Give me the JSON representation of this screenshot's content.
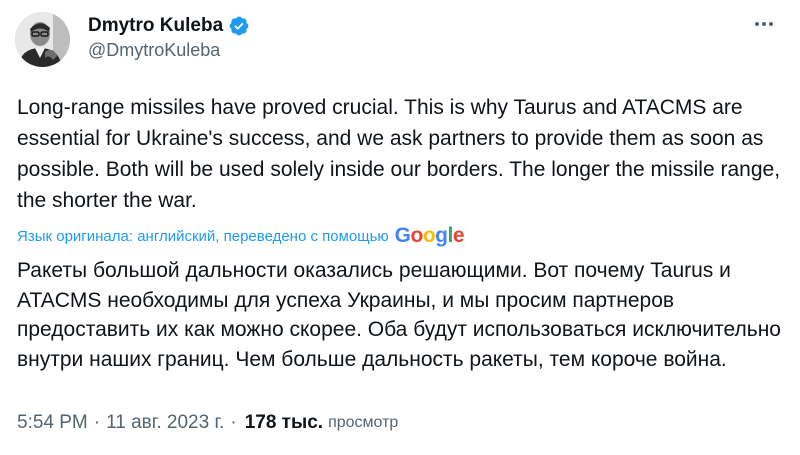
{
  "author": {
    "display_name": "Dmytro Kuleba",
    "handle": "@DmytroKuleba",
    "avatar_icon": "person-avatar-icon",
    "verified_icon": "verified-badge-icon",
    "verified_color": "#1d9bf0"
  },
  "menu": {
    "icon": "more-options-icon"
  },
  "tweet": {
    "text": "Long-range missiles have proved crucial. This is why Taurus and ATACMS are essential for Ukraine's success, and we ask partners to provide them as soon as possible. Both will be used solely inside our borders. The longer the missile range, the shorter the war."
  },
  "translation": {
    "notice": "Язык оригинала: английский, переведено с помощью",
    "provider_letters": [
      "G",
      "o",
      "o",
      "g",
      "l",
      "e"
    ],
    "provider_colors": [
      "#4285f4",
      "#ea4335",
      "#fbbc05",
      "#4285f4",
      "#34a853",
      "#ea4335"
    ],
    "text": "Ракеты большой дальности оказались решающими. Вот почему Taurus и ATACMS необходимы для успеха Украины, и мы просим партнеров предоставить их как можно скорее. Оба будут использоваться исключительно внутри наших границ. Чем больше дальность ракеты, тем короче война."
  },
  "meta": {
    "time": "5:54 PM",
    "separator": "·",
    "date": "11 авг. 2023 г.",
    "views_count": "178 тыс.",
    "views_label": "просмотр"
  },
  "colors": {
    "text_primary": "#0f1419",
    "text_secondary": "#536471",
    "link": "#1d9bf0"
  }
}
